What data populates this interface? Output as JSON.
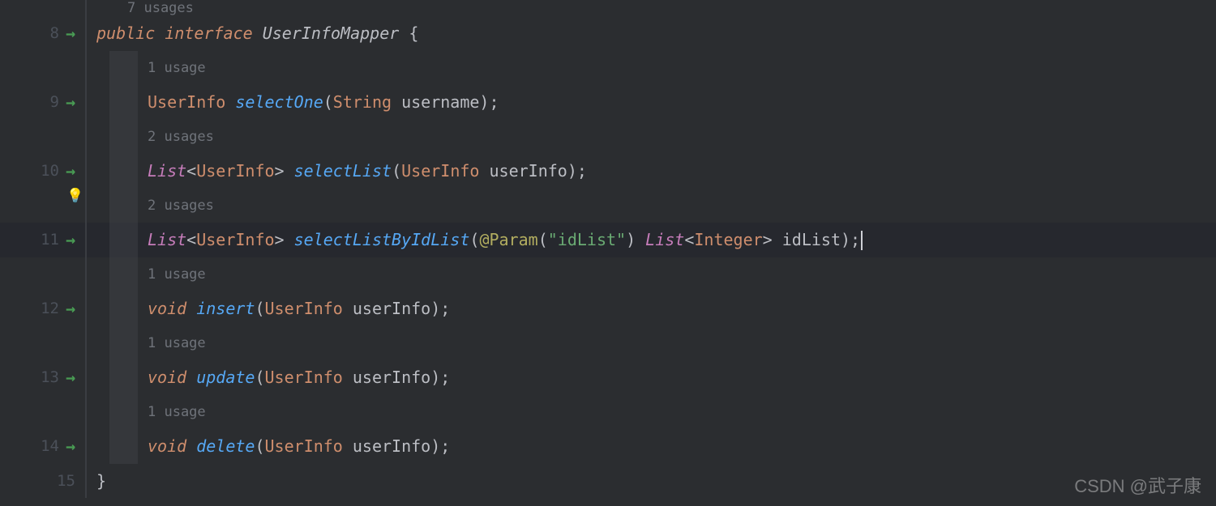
{
  "gutter": {
    "lines": [
      "8",
      "9",
      "10",
      "11",
      "12",
      "13",
      "14",
      "15"
    ],
    "arrows": [
      "8",
      "9",
      "10",
      "11",
      "12",
      "13",
      "14"
    ]
  },
  "usages": {
    "top": "7 usages",
    "u1": "1 usage",
    "u2a": "2 usages",
    "u2b": "2 usages",
    "u1b": "1 usage",
    "u1c": "1 usage",
    "u1d": "1 usage"
  },
  "code": {
    "l8": {
      "kw1": "public",
      "kw2": "interface",
      "name": "UserInfoMapper",
      "brace": "{"
    },
    "l9": {
      "ret": "UserInfo",
      "method": "selectOne",
      "pType": "String",
      "pName": "username"
    },
    "l10": {
      "ret": "List",
      "gen": "UserInfo",
      "method": "selectList",
      "pType": "UserInfo",
      "pName": "userInfo"
    },
    "l11": {
      "ret": "List",
      "gen": "UserInfo",
      "method": "selectListByIdList",
      "ann": "@Param",
      "annArg": "\"idList\"",
      "pRet": "List",
      "pGen": "Integer",
      "pName": "idList"
    },
    "l12": {
      "ret": "void",
      "method": "insert",
      "pType": "UserInfo",
      "pName": "userInfo"
    },
    "l13": {
      "ret": "void",
      "method": "update",
      "pType": "UserInfo",
      "pName": "userInfo"
    },
    "l14": {
      "ret": "void",
      "method": "delete",
      "pType": "UserInfo",
      "pName": "userInfo"
    },
    "l15": {
      "brace": "}"
    }
  },
  "watermark": "CSDN @武子康",
  "bulb": "💡"
}
